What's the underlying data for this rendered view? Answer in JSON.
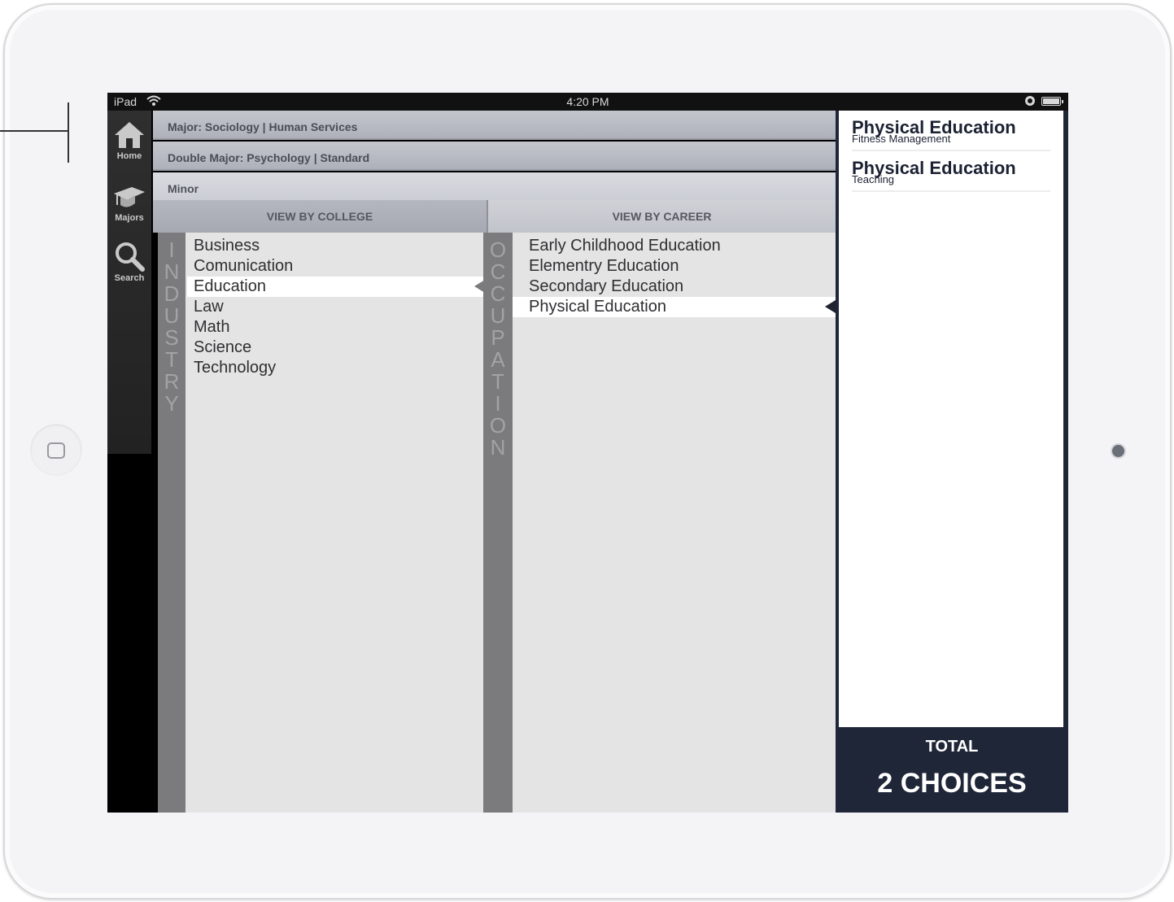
{
  "statusbar": {
    "device": "iPad",
    "time": "4:20 PM"
  },
  "nav": {
    "items": [
      {
        "label": "Home",
        "icon": "home-icon"
      },
      {
        "label": "Majors",
        "icon": "graduation-cap-icon"
      },
      {
        "label": "Search",
        "icon": "search-icon"
      }
    ]
  },
  "header": {
    "major": "Major: Sociology | Human Services",
    "double_major": "Double Major: Psychology | Standard",
    "minor": "Minor"
  },
  "tabs": {
    "college": "VIEW BY COLLEGE",
    "career": "VIEW BY CAREER"
  },
  "industry": {
    "label_letters": [
      "I",
      "N",
      "D",
      "U",
      "S",
      "T",
      "R",
      "Y"
    ],
    "items": [
      "Business",
      "Comunication",
      "Education",
      "Law",
      "Math",
      "Science",
      "Technology"
    ],
    "selected": "Education"
  },
  "occupation": {
    "label_letters": [
      "O",
      "C",
      "C",
      "U",
      "P",
      "A",
      "T",
      "I",
      "O",
      "N"
    ],
    "items": [
      "Early Childhood Education",
      "Elementry Education",
      "Secondary Education",
      "Physical Education"
    ],
    "selected": "Physical Education"
  },
  "choices": {
    "items": [
      {
        "title": "Physical Education",
        "subtitle": "Fitness Management"
      },
      {
        "title": "Physical Education",
        "subtitle": "Teaching"
      }
    ],
    "total_label": "TOTAL",
    "total_value": "2 CHOICES"
  },
  "colors": {
    "panel_navy": "#1f2638",
    "strip_gray": "#7b7b7d",
    "list_bg": "#e4e4e4"
  }
}
